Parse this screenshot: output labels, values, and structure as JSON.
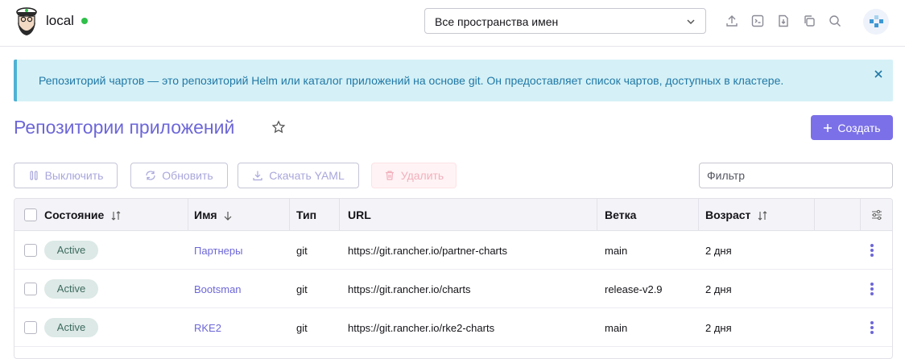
{
  "header": {
    "cluster_name": "local",
    "namespace_select": "Все пространства имен"
  },
  "banner": {
    "message": "Репозиторий чартов — это репозиторий Helm или каталог приложений на основе git. Он предоставляет список чартов, доступных в кластере."
  },
  "page": {
    "title": "Репозитории приложений",
    "create_label": "Создать"
  },
  "actions": {
    "disable": "Выключить",
    "refresh": "Обновить",
    "download_yaml": "Скачать YAML",
    "delete": "Удалить"
  },
  "filter": {
    "placeholder": "Фильтр"
  },
  "table": {
    "columns": {
      "state": "Состояние",
      "name": "Имя",
      "type": "Тип",
      "url": "URL",
      "branch": "Ветка",
      "age": "Возраст"
    },
    "rows": [
      {
        "state": "Active",
        "name": "Партнеры",
        "type": "git",
        "url": "https://git.rancher.io/partner-charts",
        "branch": "main",
        "age": "2 дня"
      },
      {
        "state": "Active",
        "name": "Bootsman",
        "type": "git",
        "url": "https://git.rancher.io/charts",
        "branch": "release-v2.9",
        "age": "2 дня"
      },
      {
        "state": "Active",
        "name": "RKE2",
        "type": "git",
        "url": "https://git.rancher.io/rke2-charts",
        "branch": "main",
        "age": "2 дня"
      }
    ]
  },
  "colors": {
    "accent": "#6d67d8",
    "primary_button": "#7b70e8",
    "banner_bg": "#d5f1f7",
    "banner_text": "#2178a6",
    "status_dot": "#2fbf4a",
    "active_badge_bg": "#dce9e6"
  },
  "icons": {
    "header": [
      "upload-icon",
      "terminal-icon",
      "download-file-icon",
      "copy-icon",
      "search-icon"
    ],
    "banner": "close-icon",
    "title": "star-icon"
  }
}
